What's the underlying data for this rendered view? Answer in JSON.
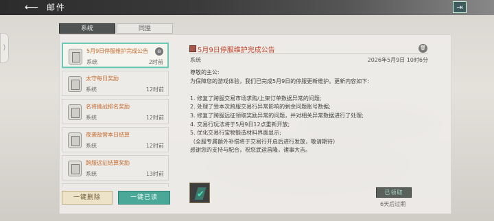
{
  "header": {
    "title": "邮件",
    "back_icon": "back-arrow-icon",
    "exit_icon": "exit-icon"
  },
  "tabs": [
    {
      "label": "系统",
      "active": true
    },
    {
      "label": "同盟",
      "active": false
    }
  ],
  "mail_list": [
    {
      "title": "5月9日停服维护完成公告",
      "sender": "系统",
      "time": "2时前",
      "selected": true,
      "badge": "⊖"
    },
    {
      "title": "太守每日奖励",
      "sender": "系统",
      "time": "12时前",
      "selected": false,
      "badge": ""
    },
    {
      "title": "名将挑战排名奖励",
      "sender": "系统",
      "time": "12时前",
      "selected": false,
      "badge": ""
    },
    {
      "title": "夜袭敌营本日结算",
      "sender": "系统",
      "time": "12时前",
      "selected": false,
      "badge": ""
    },
    {
      "title": "跨服远征结算奖励",
      "sender": "系统",
      "time": "13时前",
      "selected": false,
      "badge": ""
    }
  ],
  "actions": {
    "delete_all": "一键删除",
    "read_all": "一键已读"
  },
  "detail": {
    "title": "5月9日停服维护完成公告",
    "sender": "系统",
    "date": "2026年5月9日 10时6分",
    "lines": [
      "尊敬的主公:",
      "为保障您的游戏体验，我们已完成5月9日的停服更新维护。更新内容如下:",
      "",
      "1. 修复了跨服交易市场求购/上架订单数据异常的问题;",
      "2. 处理了受本次跨服交易行异常影响的剩余问题账号数据;",
      "3. 修复了跨服远征领取奖励异常的问题，并对相关异常数据进行了处理;",
      "4. 交易行玩法将于5月9日12点重新开放;",
      "5. 优化交易行宝物锻造材料界面显示;",
      "（全服专属额外补偿将于交易行开启后进行发放，敬请期待）",
      "感谢您的支持与配合，祝您武运昌隆，诸事大吉。"
    ],
    "claim_label": "已领取",
    "expire_text": "6天后过期"
  },
  "colors": {
    "accent": "#4aa898",
    "title_red": "#c0442b",
    "item_orange": "#c66a2e"
  }
}
